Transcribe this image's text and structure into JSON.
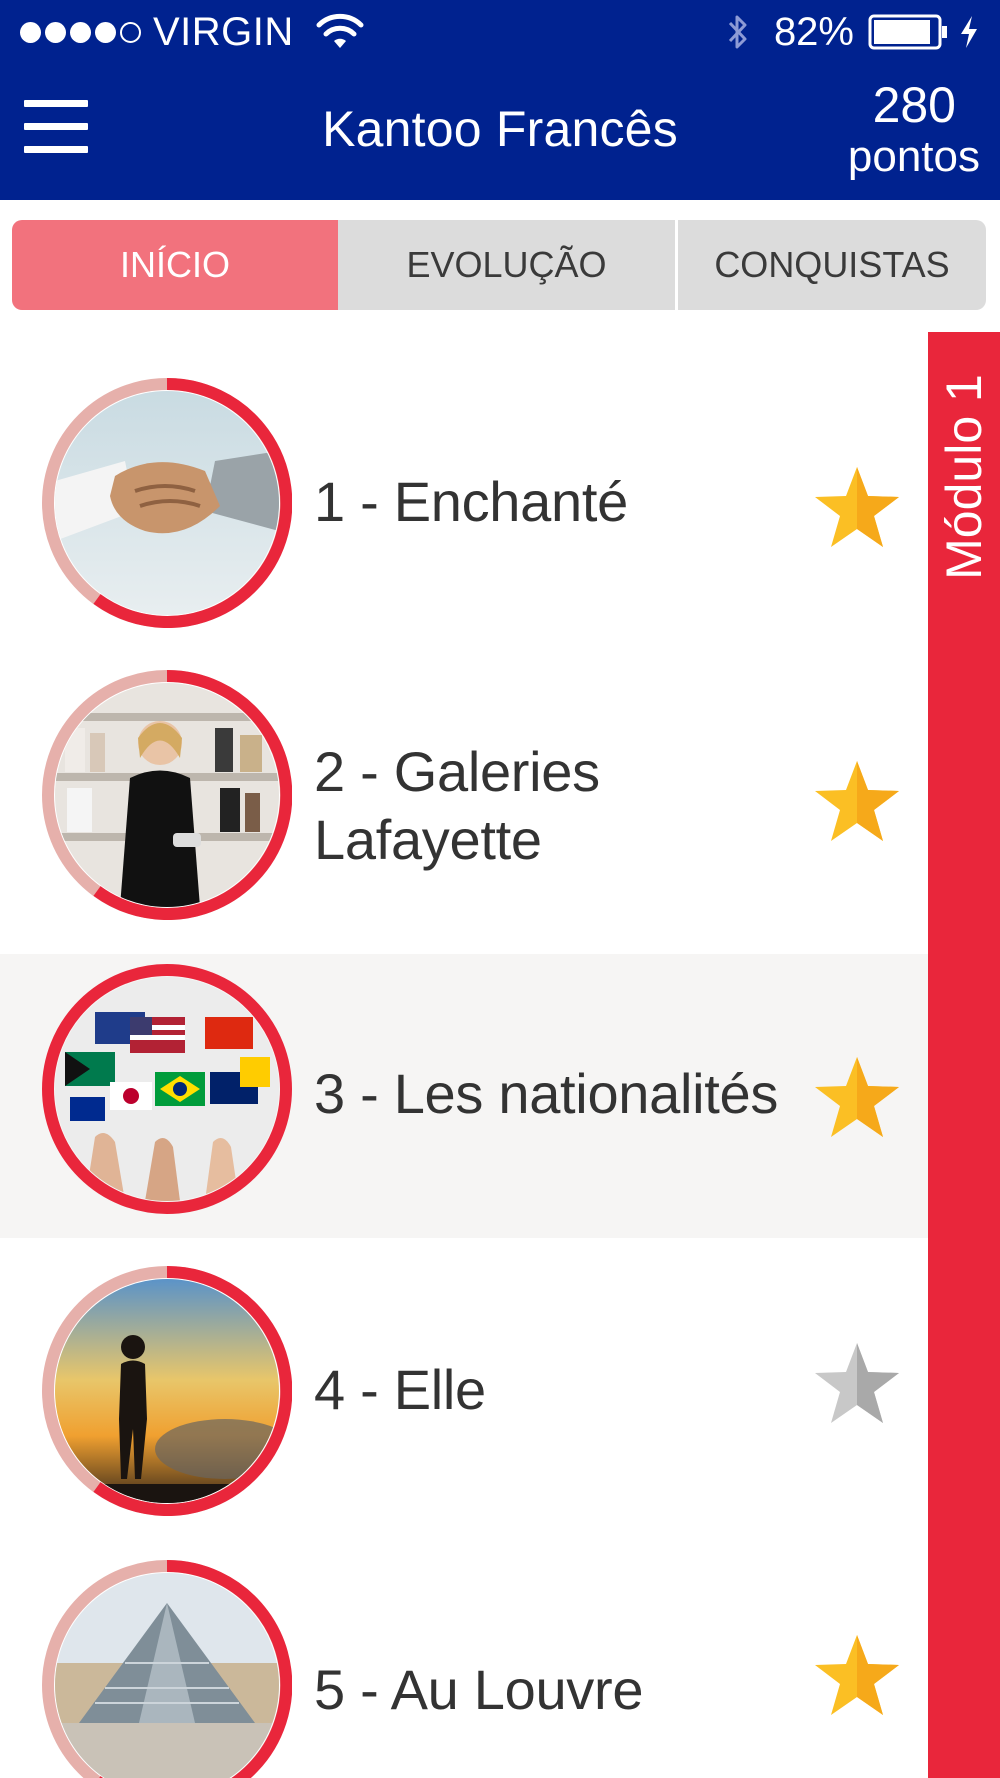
{
  "status_bar": {
    "carrier": "VIRGIN",
    "signal_bars": 4,
    "battery_percent": "82%",
    "icons": [
      "wifi-icon",
      "bluetooth-icon",
      "battery-icon",
      "charging-bolt-icon"
    ]
  },
  "header": {
    "title": "Kantoo Francês",
    "score_value": "280",
    "score_unit": "pontos",
    "menu_icon": "hamburger-menu-icon",
    "background_color": "#00228f"
  },
  "tabs": [
    {
      "label": "INÍCIO",
      "active": true
    },
    {
      "label": "EVOLUÇÃO",
      "active": false
    },
    {
      "label": "CONQUISTAS",
      "active": false
    }
  ],
  "module": {
    "label": "Módulo 1",
    "color": "#e9263b"
  },
  "lessons": [
    {
      "title": "1 - Enchanté",
      "image": "handshake-photo",
      "completed_star": true,
      "selected": false
    },
    {
      "title": "2 - Galeries Lafayette",
      "image": "shop-assistant-photo",
      "completed_star": true,
      "selected": false
    },
    {
      "title": "3 - Les nationalités",
      "image": "flags-photo",
      "completed_star": true,
      "selected": true
    },
    {
      "title": "4 - Elle",
      "image": "woman-silhouette-sunset-photo",
      "completed_star": false,
      "selected": false
    },
    {
      "title": "5 - Au Louvre",
      "image": "louvre-pyramid-photo",
      "completed_star": true,
      "selected": false
    }
  ],
  "colors": {
    "accent_red": "#e9263b",
    "tab_active": "#f2727d",
    "star_gold": "#fbbf24",
    "star_gray": "#b8b8b8"
  }
}
